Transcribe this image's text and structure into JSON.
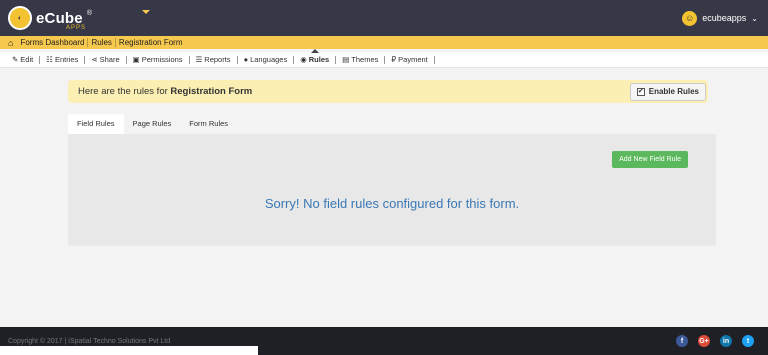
{
  "header": {
    "logo_text": "eCube",
    "logo_sub": "APPS",
    "logo_reg": "®",
    "user_name": "ecubeapps"
  },
  "breadcrumb": [
    "Forms Dashboard",
    "Rules",
    "Registration Form"
  ],
  "toolbar": [
    {
      "icon": "edit-icon",
      "glyph": "✎",
      "label": "Edit"
    },
    {
      "icon": "entries-icon",
      "glyph": "☷",
      "label": "Entries"
    },
    {
      "icon": "share-icon",
      "glyph": "⋖",
      "label": "Share"
    },
    {
      "icon": "lock-icon",
      "glyph": "🔒",
      "label": "Permissions"
    },
    {
      "icon": "reports-icon",
      "glyph": "☰",
      "label": "Reports"
    },
    {
      "icon": "globe-icon",
      "glyph": "●",
      "label": "Languages"
    },
    {
      "icon": "eye-icon",
      "glyph": "◉",
      "label": "Rules",
      "active": true
    },
    {
      "icon": "themes-icon",
      "glyph": "▤",
      "label": "Themes"
    },
    {
      "icon": "payment-icon",
      "glyph": "₽",
      "label": "Payment"
    }
  ],
  "notice": {
    "prefix": "Here are the rules for ",
    "form_name": "Registration Form",
    "enable_label": "Enable Rules",
    "enable_checked": "✔"
  },
  "tabs": [
    "Field Rules",
    "Page Rules",
    "Form Rules"
  ],
  "panel": {
    "add_button": "Add New Field Rule",
    "empty_message": "Sorry! No field rules configured for this form."
  },
  "footer": {
    "copyright": "Copyright © 2017 | iSpatial Techno Solutions Pvt Ltd",
    "socials": [
      {
        "name": "facebook-icon",
        "glyph": "f"
      },
      {
        "name": "google-plus-icon",
        "glyph": "G+"
      },
      {
        "name": "linkedin-icon",
        "glyph": "in"
      },
      {
        "name": "twitter-icon",
        "glyph": "t"
      }
    ]
  },
  "colors": {
    "header_bg": "#363847",
    "accent_yellow": "#f7c84e",
    "notice_bg": "#fcefb4",
    "button_green": "#5cb85c",
    "message_blue": "#3a78b5"
  }
}
